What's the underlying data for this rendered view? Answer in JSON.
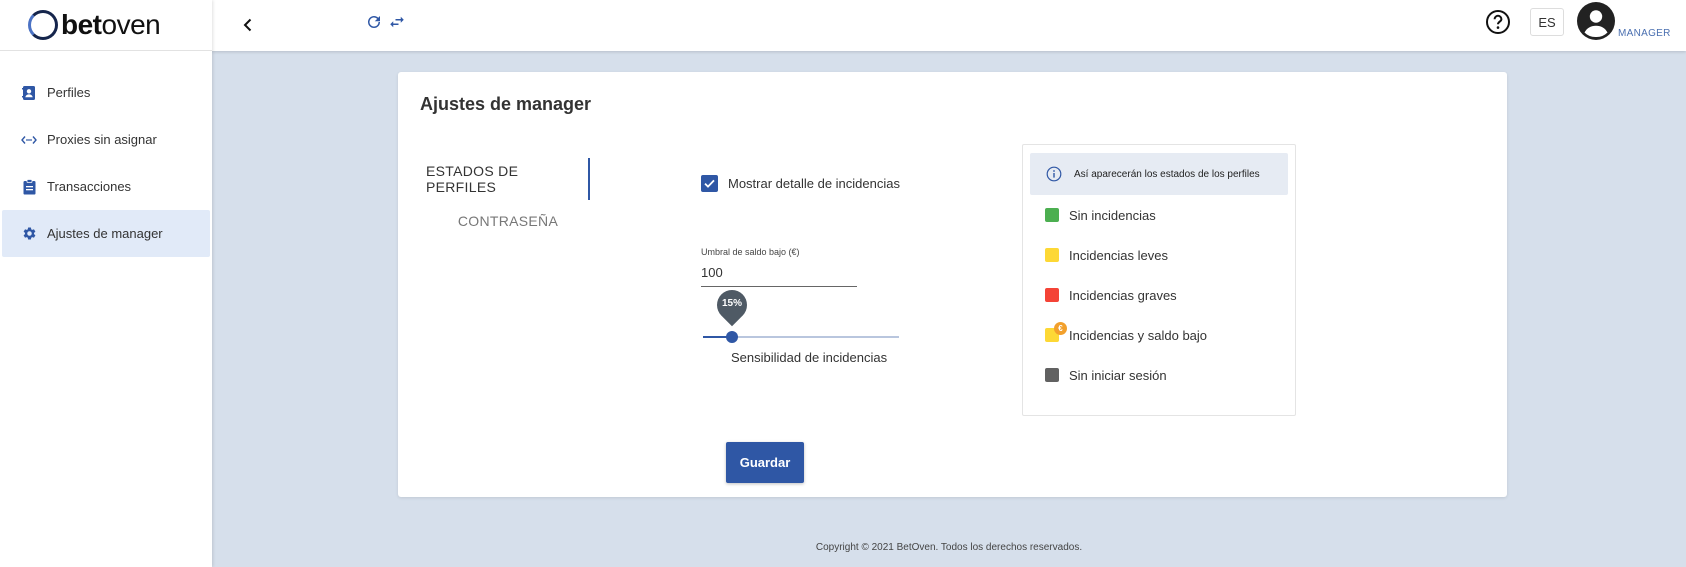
{
  "brand": {
    "name_bold": "bet",
    "name_rest": "oven"
  },
  "sidebar": {
    "items": [
      {
        "label": "Perfiles",
        "icon": "contact-card-icon"
      },
      {
        "label": "Proxies sin asignar",
        "icon": "code-arrows-icon"
      },
      {
        "label": "Transacciones",
        "icon": "clipboard-icon"
      },
      {
        "label": "Ajustes de manager",
        "icon": "gear-icon",
        "active": true
      }
    ]
  },
  "topbar": {
    "language": "ES",
    "role": "MANAGER"
  },
  "card": {
    "title": "Ajustes de manager",
    "tabs": [
      {
        "label": "ESTADOS DE PERFILES",
        "active": true
      },
      {
        "label": "CONTRASEÑA",
        "active": false
      }
    ],
    "checkbox": {
      "label": "Mostrar detalle de incidencias",
      "checked": true
    },
    "threshold": {
      "label": "Umbral de saldo bajo (€)",
      "value": "100"
    },
    "sensitivity": {
      "label": "Sensibilidad de incidencias",
      "display": "15%",
      "percent": 15
    },
    "save_label": "Guardar"
  },
  "legend": {
    "info": "Así aparecerán los estados de los perfiles",
    "items": [
      {
        "label": "Sin incidencias",
        "color": "#4caf50"
      },
      {
        "label": "Incidencias leves",
        "color": "#fdd835"
      },
      {
        "label": "Incidencias graves",
        "color": "#f44336"
      },
      {
        "label": "Incidencias y saldo bajo",
        "color": "#fdd835",
        "badge": "€"
      },
      {
        "label": "Sin iniciar sesión",
        "color": "#616161"
      }
    ]
  },
  "colors": {
    "primary": "#2f57a5",
    "background": "#d6dfeb",
    "active_nav": "#e1eaf8"
  },
  "footer": "Copyright © 2021 BetOven. Todos los derechos reservados."
}
